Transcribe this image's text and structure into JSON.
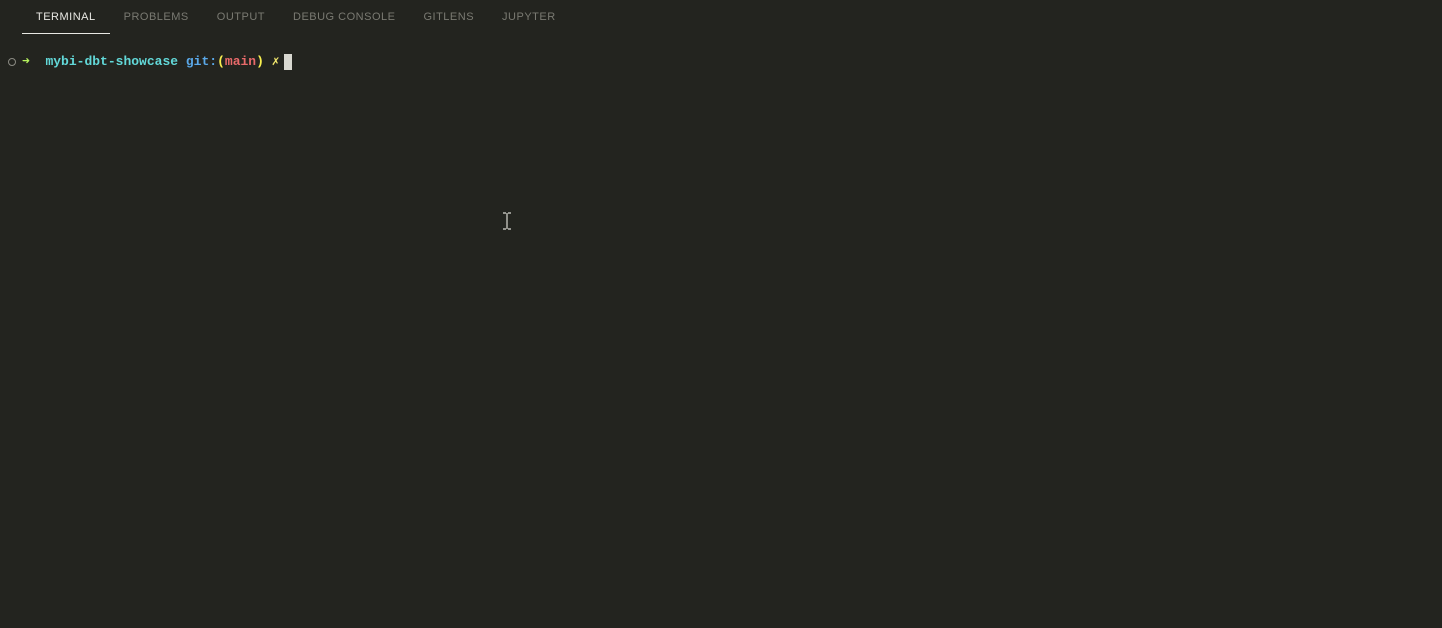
{
  "tabs": [
    {
      "label": "TERMINAL",
      "active": true
    },
    {
      "label": "PROBLEMS",
      "active": false
    },
    {
      "label": "OUTPUT",
      "active": false
    },
    {
      "label": "DEBUG CONSOLE",
      "active": false
    },
    {
      "label": "GITLENS",
      "active": false
    },
    {
      "label": "JUPYTER",
      "active": false
    }
  ],
  "prompt": {
    "arrow": "➜",
    "dir": "mybi-dbt-showcase",
    "git_label": "git:",
    "paren_open": "(",
    "branch": "main",
    "paren_close": ")",
    "dirty": "✗"
  }
}
